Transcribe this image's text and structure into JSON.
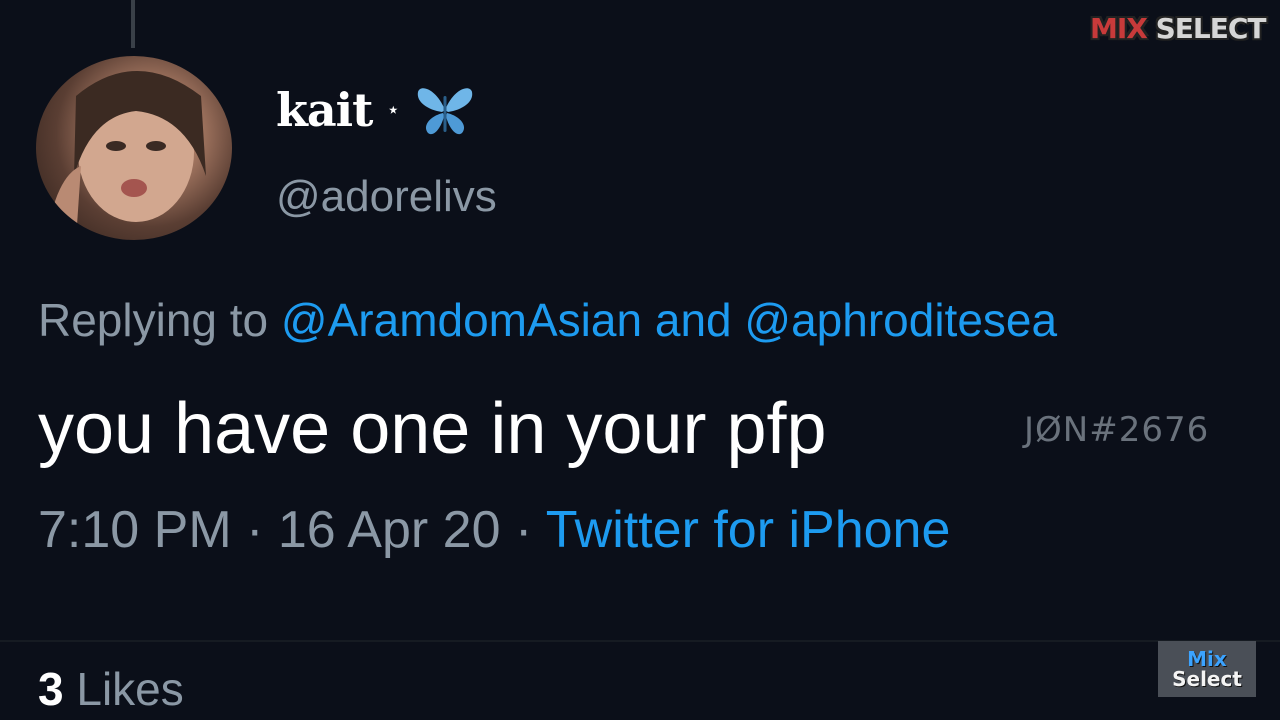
{
  "tweet": {
    "display_name": "kait",
    "name_decoration": "⋆",
    "handle": "@adorelivs",
    "reply_prefix": "Replying to ",
    "reply_mention_1": "@AramdomAsian",
    "reply_conjunction": " and ",
    "reply_mention_2": "@aphroditesea",
    "text": "you have one in your pfp",
    "time": "7:10 PM · 16 Apr 20 · ",
    "source": "Twitter for iPhone",
    "likes_count": "3",
    "likes_label": " Likes"
  },
  "overlay": {
    "id_watermark": "JØN#2676",
    "logo_top_mix": "MIX",
    "logo_top_select": " SELECT",
    "logo_bottom_line1": "Mix",
    "logo_bottom_line2": "Select"
  },
  "colors": {
    "background": "#0b0f19",
    "link_blue": "#1d9bf0",
    "secondary_text": "#8b98a5",
    "butterfly": "#6fb6e8"
  },
  "icons": {
    "avatar": "profile-photo",
    "star": "star-icon",
    "butterfly": "butterfly-icon"
  }
}
